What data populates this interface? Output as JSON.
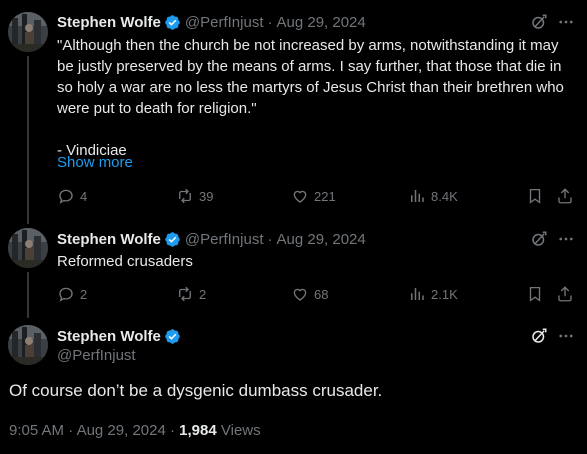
{
  "tweets": [
    {
      "author_name": "Stephen Wolfe",
      "handle": "@PerfInjust",
      "separator": "·",
      "date": "Aug 29, 2024",
      "text": "\"Although then the church be not increased by arms, notwithstanding it may be justly preserved by the means of arms. I say further, that those that die in so holy a war are no less the martyrs of Jesus Christ than their brethren who were put to death for religion.\"\n\n- Vindiciae",
      "show_more": "Show more",
      "replies": "4",
      "reposts": "39",
      "likes": "221",
      "views": "8.4K"
    },
    {
      "author_name": "Stephen Wolfe",
      "handle": "@PerfInjust",
      "separator": "·",
      "date": "Aug 29, 2024",
      "text": "Reformed crusaders",
      "replies": "2",
      "reposts": "2",
      "likes": "68",
      "views": "2.1K"
    }
  ],
  "main_tweet": {
    "author_name": "Stephen Wolfe",
    "handle": "@PerfInjust",
    "text": "Of course don’t be a dysgenic dumbass crusader.",
    "time": "9:05 AM",
    "separator": "·",
    "date": "Aug 29, 2024",
    "views_count": "1,984",
    "views_label": "Views"
  },
  "colors": {
    "background": "#000000",
    "text": "#e7e9ea",
    "muted": "#71767b",
    "accent": "#1d9bf0"
  }
}
